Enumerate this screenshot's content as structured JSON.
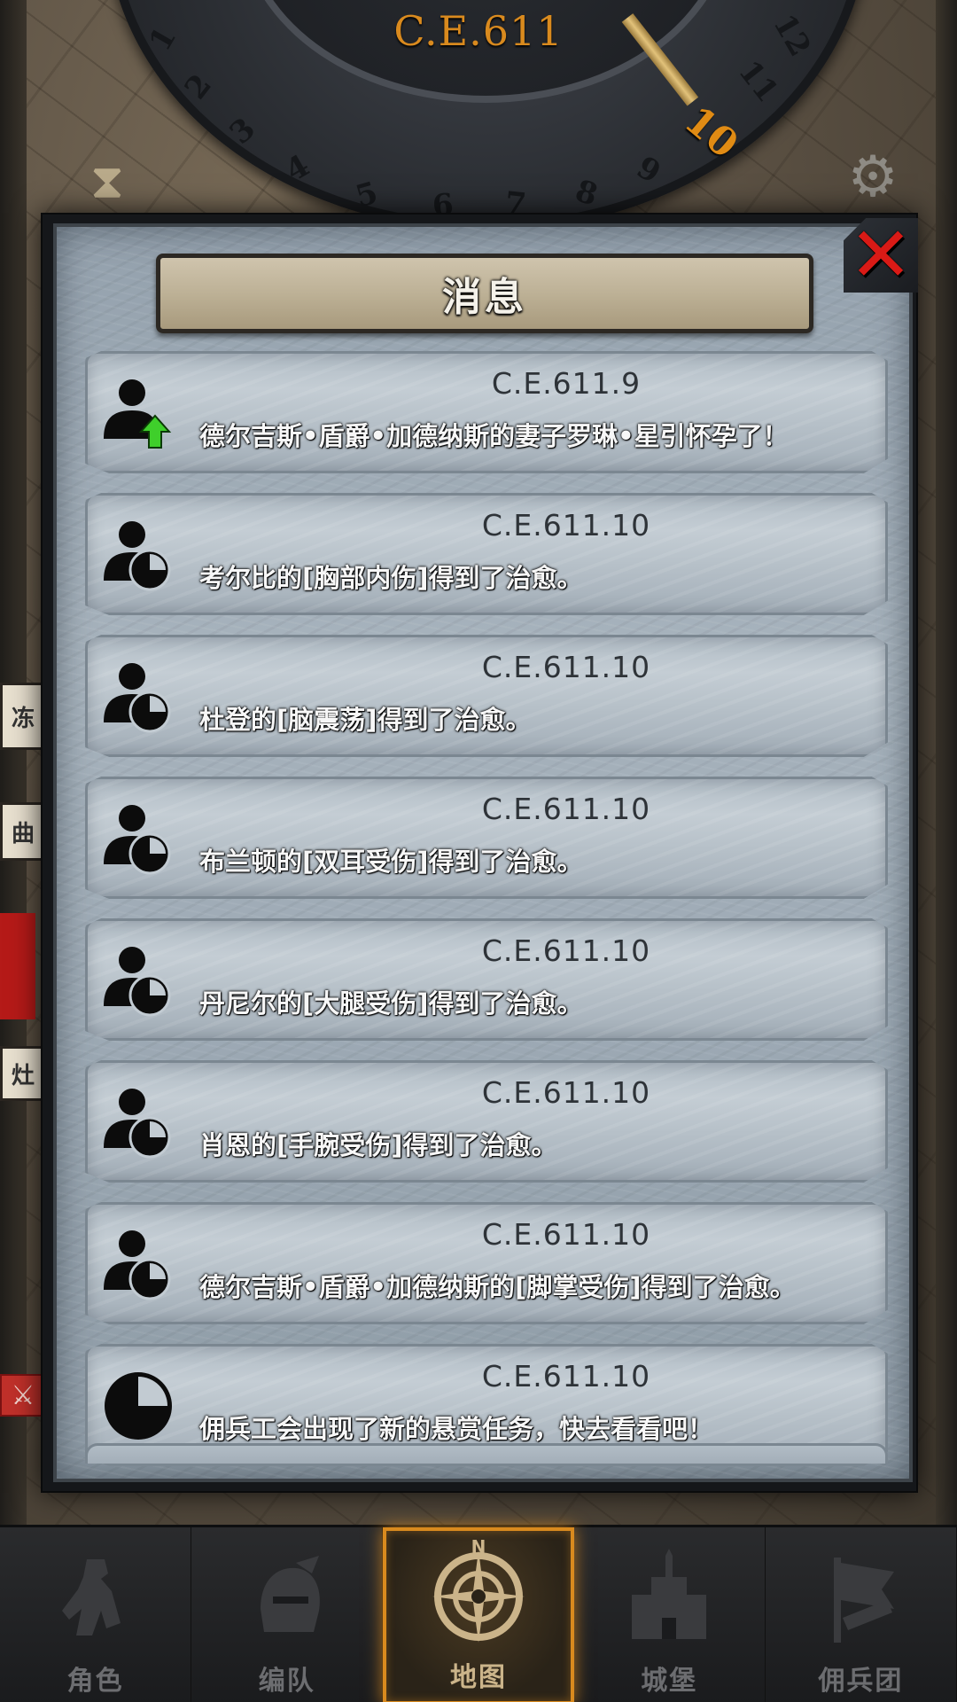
{
  "header": {
    "era": "C.E.611",
    "dial_numbers": [
      "1",
      "2",
      "3",
      "4",
      "5",
      "6",
      "7",
      "8",
      "9",
      "10",
      "11",
      "12"
    ],
    "active_month": "10",
    "hourglass_icon": "hourglass-icon",
    "settings_icon": "gear-icon"
  },
  "map_fragments": {
    "label_a": "冻",
    "label_b": "曲",
    "label_c": "灶",
    "sword_icon": "crossed-swords-icon"
  },
  "modal": {
    "title": "消息",
    "close_icon": "close-icon",
    "messages": [
      {
        "date": "C.E.611.9",
        "text": "德尔吉斯•盾爵•加德纳斯的妻子罗琳•星引怀孕了！",
        "icon": "person-up-icon"
      },
      {
        "date": "C.E.611.10",
        "text": "考尔比的[胸部内伤]得到了治愈。",
        "icon": "person-clock-icon"
      },
      {
        "date": "C.E.611.10",
        "text": "杜登的[脑震荡]得到了治愈。",
        "icon": "person-clock-icon"
      },
      {
        "date": "C.E.611.10",
        "text": "布兰顿的[双耳受伤]得到了治愈。",
        "icon": "person-clock-icon"
      },
      {
        "date": "C.E.611.10",
        "text": "丹尼尔的[大腿受伤]得到了治愈。",
        "icon": "person-clock-icon"
      },
      {
        "date": "C.E.611.10",
        "text": "肖恩的[手腕受伤]得到了治愈。",
        "icon": "person-clock-icon"
      },
      {
        "date": "C.E.611.10",
        "text": "德尔吉斯•盾爵•加德纳斯的[脚掌受伤]得到了治愈。",
        "icon": "person-clock-icon"
      },
      {
        "date": "C.E.611.10",
        "text": "佣兵工会出现了新的悬赏任务，快去看看吧！",
        "icon": "clock-icon"
      }
    ]
  },
  "nav": {
    "items": [
      {
        "label": "角色",
        "icon": "knight-icon",
        "active": false
      },
      {
        "label": "编队",
        "icon": "helmet-icon",
        "active": false
      },
      {
        "label": "地图",
        "icon": "compass-icon",
        "active": true
      },
      {
        "label": "城堡",
        "icon": "castle-icon",
        "active": false
      },
      {
        "label": "佣兵团",
        "icon": "banner-icon",
        "active": false
      }
    ],
    "compass_letter": "N"
  },
  "colors": {
    "accent_orange": "#d98a1e",
    "close_red": "#d91a16",
    "arrow_green": "#3fcf2b",
    "panel_blue_grey": "#a7b3bd"
  }
}
